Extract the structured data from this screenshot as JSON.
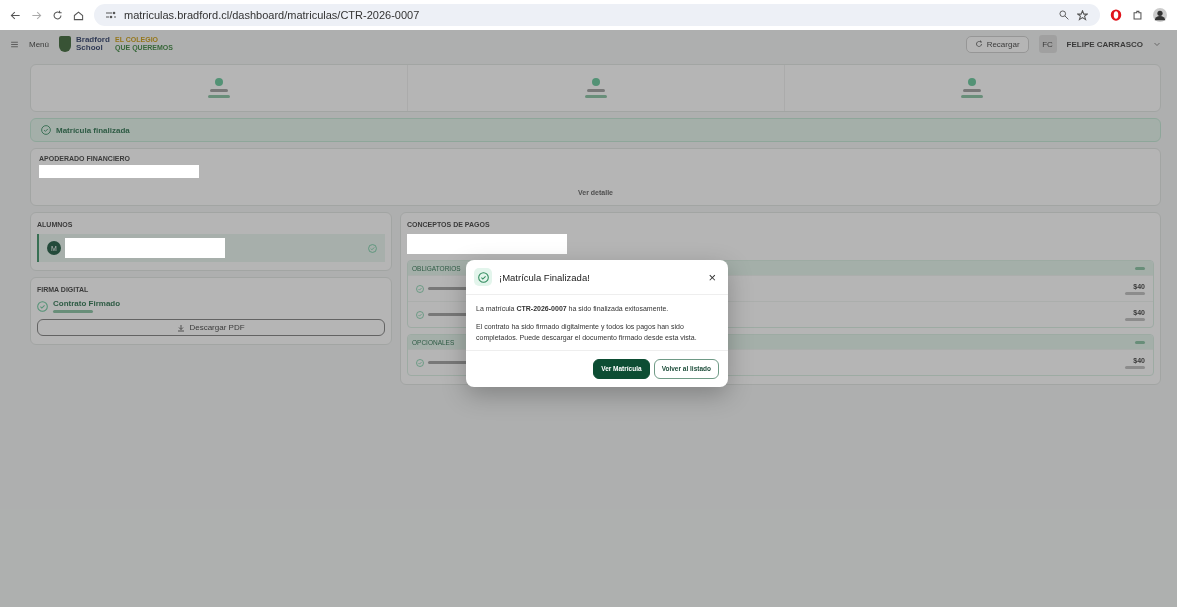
{
  "browser": {
    "url": "matriculas.bradford.cl/dashboard/matriculas/CTR-2026-0007"
  },
  "header": {
    "menu": "Menú",
    "logo_name": "Bradford School",
    "logo_tagline_top": "EL COLEGIO",
    "logo_tagline_bottom": "QUE QUEREMOS",
    "reload": "Recargar",
    "user_initials": "FC",
    "user_name": "FELIPE CARRASCO"
  },
  "steps": [
    {
      "done": true
    },
    {
      "done": true
    },
    {
      "done": true
    }
  ],
  "banner": "Matrícula finalizada",
  "guardian": {
    "title": "APODERADO FINANCIERO",
    "more": "Ver detalle"
  },
  "students": {
    "title": "ALUMNOS",
    "initial": "M"
  },
  "signature": {
    "title": "FIRMA DIGITAL",
    "status": "Contrato Firmado",
    "download": "Descargar PDF"
  },
  "payments": {
    "title": "CONCEPTOS DE PAGOS",
    "groups": [
      {
        "name": "OBLIGATORIOS",
        "items": [
          {
            "amount": "$40"
          },
          {
            "amount": "$40"
          }
        ]
      },
      {
        "name": "OPCIONALES",
        "items": [
          {
            "amount": "$40"
          }
        ]
      }
    ]
  },
  "dialog": {
    "title": "¡Matrícula Finalizada!",
    "close": "×",
    "message": "La matrícula **CTR-2026-0007** ha sido finalizada exitosamente.",
    "detail": "El contrato ha sido firmado digitalmente y todos los pagos han sido completados. Puede descargar el documento firmado desde esta vista.",
    "primary": "Ver Matrícula",
    "secondary": "Volver al listado"
  }
}
